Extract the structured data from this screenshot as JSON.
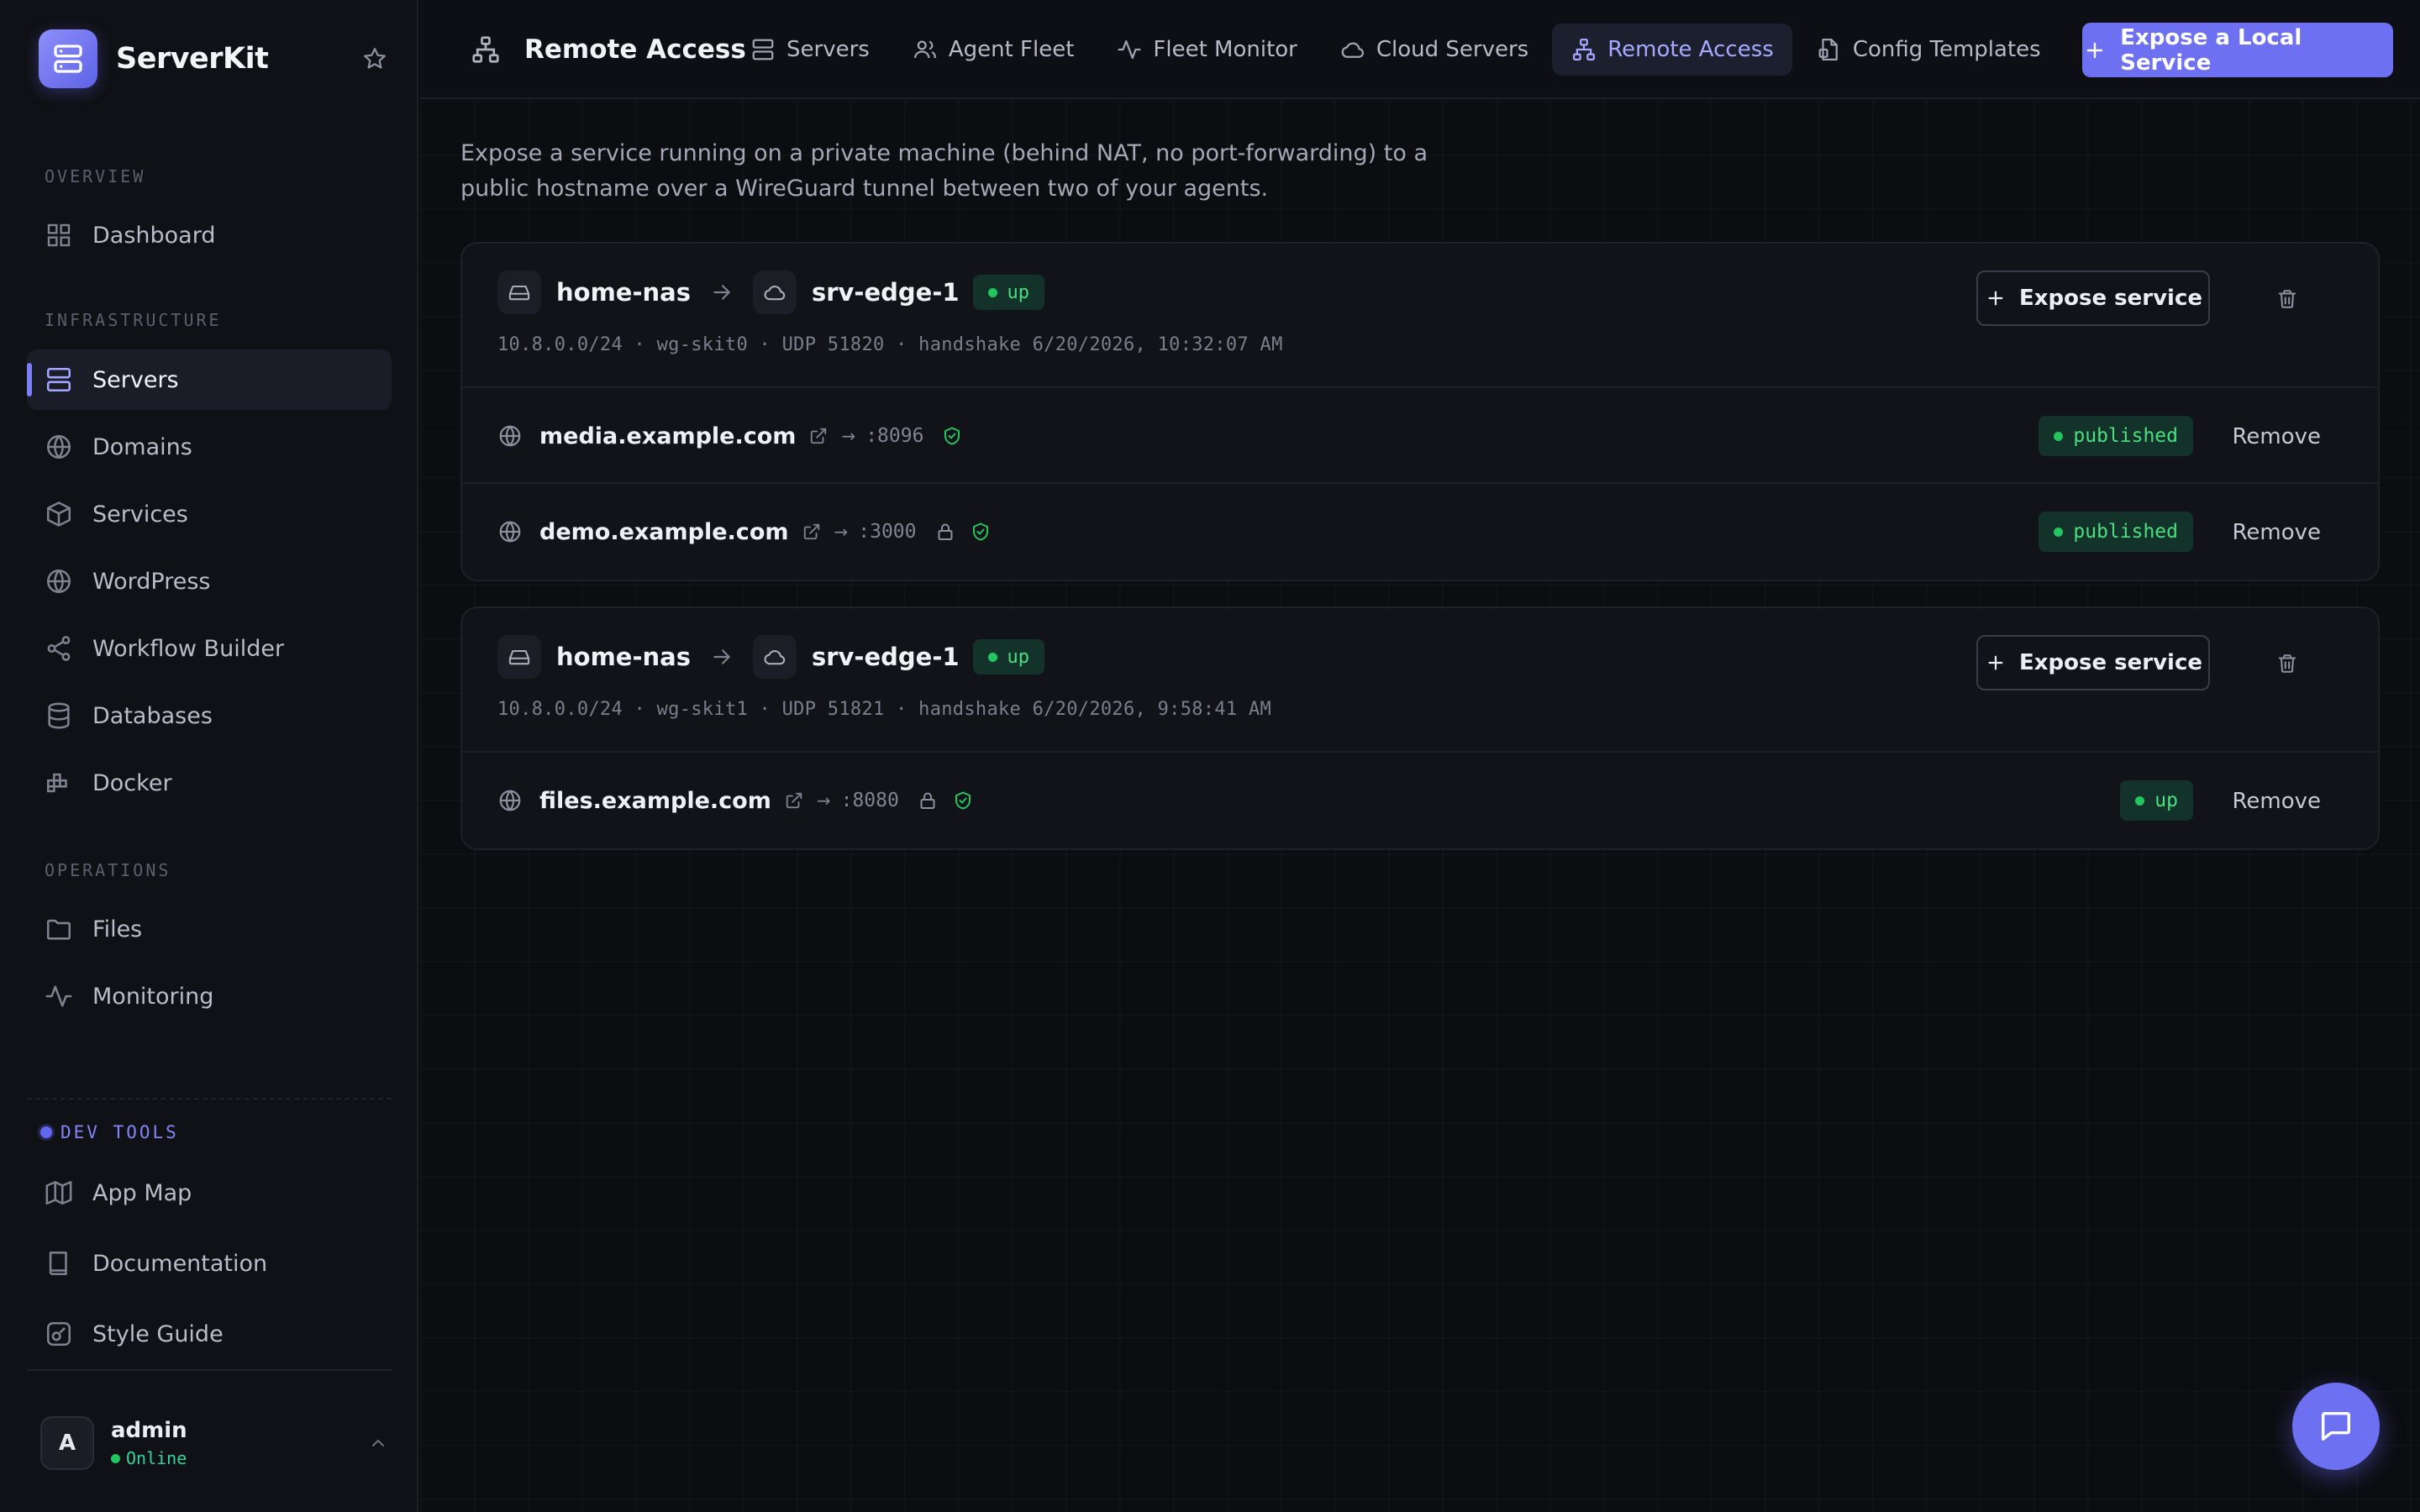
{
  "app": {
    "name": "ServerKit"
  },
  "sidebar": {
    "sections": {
      "overview": "OVERVIEW",
      "infrastructure": "INFRASTRUCTURE",
      "operations": "OPERATIONS",
      "devtools": "DEV TOOLS"
    },
    "items": {
      "dashboard": "Dashboard",
      "servers": "Servers",
      "domains": "Domains",
      "services": "Services",
      "wordpress": "WordPress",
      "workflow_builder": "Workflow Builder",
      "databases": "Databases",
      "docker": "Docker",
      "files": "Files",
      "monitoring": "Monitoring",
      "app_map": "App Map",
      "documentation": "Documentation",
      "style_guide": "Style Guide"
    },
    "active_item": "Servers",
    "user": {
      "initial": "A",
      "name": "admin",
      "status": "Online"
    }
  },
  "header": {
    "title": "Remote Access",
    "tabs": [
      {
        "label": "Servers",
        "icon": "server-icon"
      },
      {
        "label": "Agent Fleet",
        "icon": "users-icon"
      },
      {
        "label": "Fleet Monitor",
        "icon": "activity-icon"
      },
      {
        "label": "Cloud Servers",
        "icon": "cloud-icon"
      },
      {
        "label": "Remote Access",
        "icon": "network-icon",
        "active": true
      },
      {
        "label": "Config Templates",
        "icon": "file-template-icon"
      }
    ],
    "primary_action": "Expose a Local Service"
  },
  "main": {
    "intro": "Expose a service running on a private machine (behind NAT, no port-forwarding) to a public hostname over a WireGuard tunnel between two of your agents.",
    "tunnels": [
      {
        "source": "home-nas",
        "target": "srv-edge-1",
        "status": "up",
        "meta": "10.8.0.0/24 · wg-skit0 · UDP 51820 · handshake 6/20/2026, 10:32:07 AM",
        "expose_label": "Expose service",
        "services": [
          {
            "host": "media.example.com",
            "arrow": "→",
            "port": ":8096",
            "locked": false,
            "status": "published",
            "remove_label": "Remove"
          },
          {
            "host": "demo.example.com",
            "arrow": "→",
            "port": ":3000",
            "locked": true,
            "status": "published",
            "remove_label": "Remove"
          }
        ]
      },
      {
        "source": "home-nas",
        "target": "srv-edge-1",
        "status": "up",
        "meta": "10.8.0.0/24 · wg-skit1 · UDP 51821 · handshake 6/20/2026, 9:58:41 AM",
        "expose_label": "Expose service",
        "services": [
          {
            "host": "files.example.com",
            "arrow": "→",
            "port": ":8080",
            "locked": true,
            "status": "up",
            "remove_label": "Remove"
          }
        ]
      }
    ]
  },
  "colors": {
    "accent": "#6d70f0",
    "success": "#22c55e",
    "background": "#0c0d11",
    "surface": "#121318"
  }
}
